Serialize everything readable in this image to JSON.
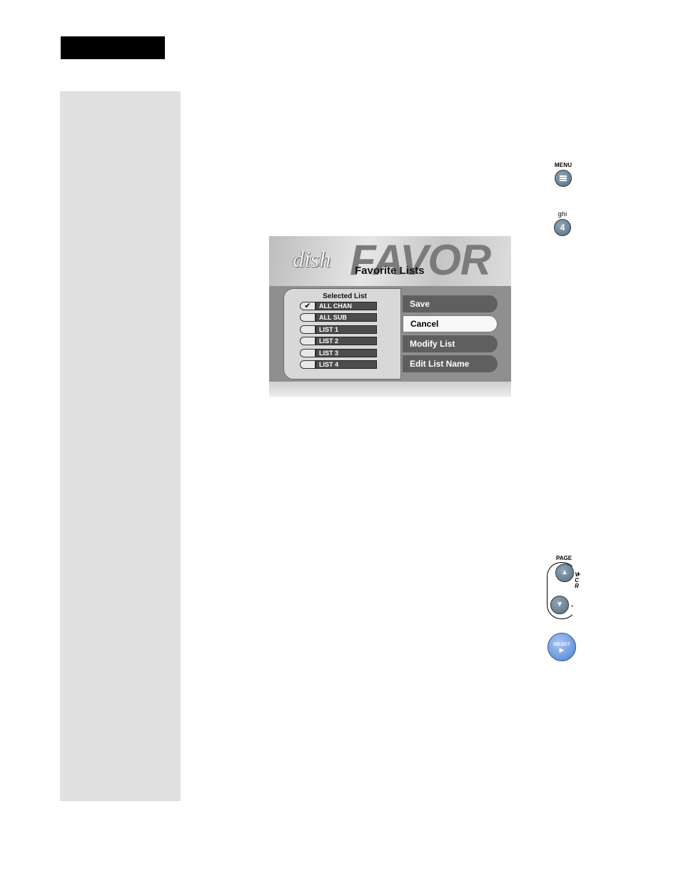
{
  "remote": {
    "menu_label": "MENU",
    "menu_icon": "menu-lines-icon",
    "ghi_label": "ghi",
    "ghi_digit": "4",
    "page_label": "PAGE",
    "page_up_glyph": "▲",
    "page_down_glyph": "▼",
    "vcr_text": "VCR",
    "plus": "+",
    "minus": "-",
    "select_label": "SELECT",
    "select_glyph": "▶"
  },
  "screen": {
    "logo": "dish",
    "banner_word": "FAVOR",
    "title": "Favorite Lists",
    "list_header": "Selected List",
    "lists": [
      {
        "label": "ALL CHAN",
        "checked": true
      },
      {
        "label": "ALL SUB",
        "checked": false
      },
      {
        "label": "LIST 1",
        "checked": false
      },
      {
        "label": "LIST 2",
        "checked": false
      },
      {
        "label": "LIST 3",
        "checked": false
      },
      {
        "label": "LIST 4",
        "checked": false
      }
    ],
    "check_glyph": "✔",
    "actions": [
      {
        "label": "Save",
        "active": false
      },
      {
        "label": "Cancel",
        "active": true
      },
      {
        "label": "Modify List",
        "active": false
      },
      {
        "label": "Edit List Name",
        "active": false
      }
    ]
  }
}
